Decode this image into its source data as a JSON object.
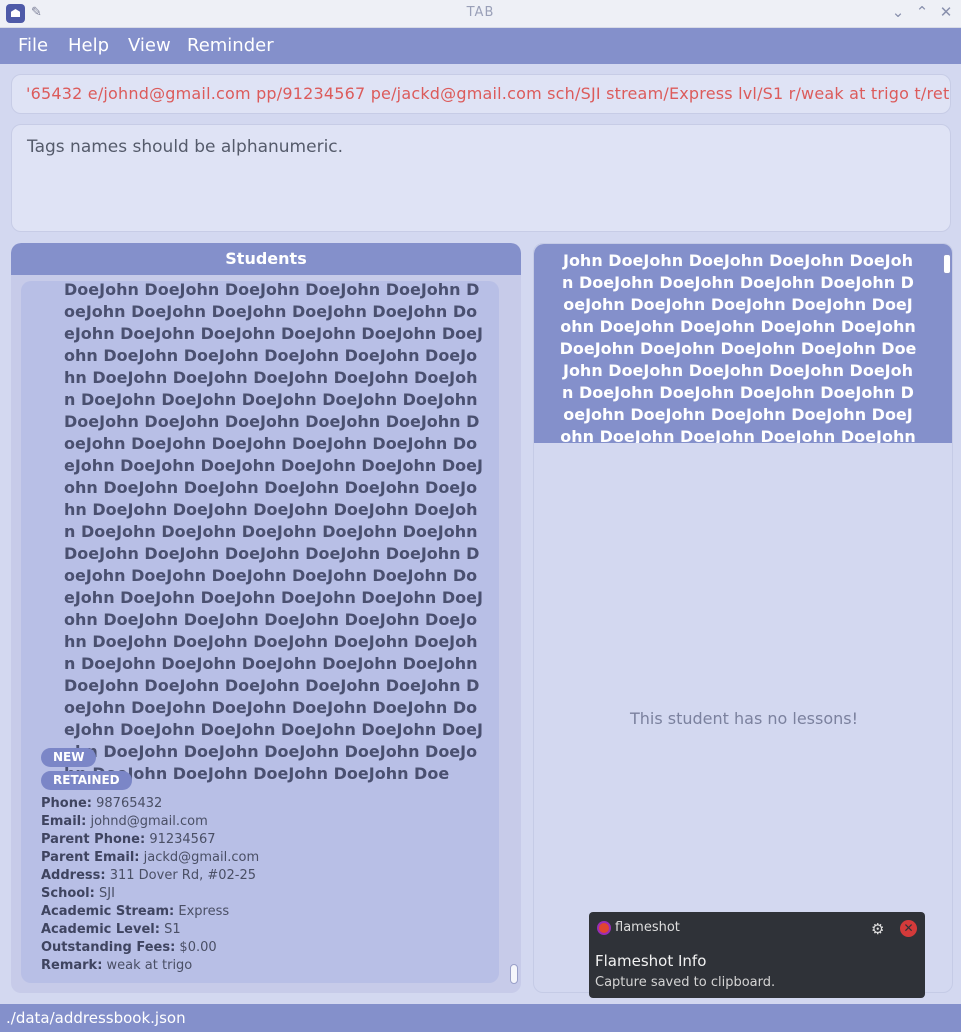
{
  "window": {
    "title": "TAB"
  },
  "menu": [
    "File",
    "Help",
    "View",
    "Reminder"
  ],
  "command": {
    "value": "'65432 e/johnd@gmail.com pp/91234567 pe/jackd@gmail.com sch/SJI stream/Express lvl/S1 r/weak at trigo t/retained t/new"
  },
  "result": {
    "message": "Tags names should be alphanumeric."
  },
  "students": {
    "header": "Students",
    "card": {
      "name": "DoeJohn DoeJohn DoeJohn DoeJohn DoeJohn DoeJohn DoeJohn DoeJohn DoeJohn DoeJohn DoeJohn DoeJohn DoeJohn DoeJohn DoeJohn DoeJohn DoeJohn DoeJohn DoeJohn DoeJohn DoeJohn DoeJohn DoeJohn DoeJohn DoeJohn DoeJohn DoeJohn DoeJohn DoeJohn DoeJohn DoeJohn DoeJohn DoeJohn DoeJohn DoeJohn DoeJohn DoeJohn DoeJohn DoeJohn DoeJohn DoeJohn DoeJohn DoeJohn DoeJohn DoeJohn DoeJohn DoeJohn DoeJohn DoeJohn DoeJohn DoeJohn DoeJohn DoeJohn DoeJohn DoeJohn DoeJohn DoeJohn DoeJohn DoeJohn DoeJohn DoeJohn DoeJohn DoeJohn DoeJohn DoeJohn DoeJohn DoeJohn DoeJohn DoeJohn DoeJohn DoeJohn DoeJohn DoeJohn DoeJohn DoeJohn DoeJohn DoeJohn DoeJohn DoeJohn DoeJohn DoeJohn DoeJohn DoeJohn DoeJohn DoeJohn DoeJohn DoeJohn DoeJohn DoeJohn DoeJohn DoeJohn DoeJohn DoeJohn DoeJohn DoeJohn DoeJohn DoeJohn DoeJohn DoeJohn DoeJohn DoeJohn DoeJohn DoeJohn DoeJohn DoeJohn DoeJohn DoeJohn DoeJohn DoeJohn DoeJohn DoeJohn DoeJohn DoeJohn DoeJohn DoeJohn DoeJohn DoeJohn DoeJohn Doe",
      "tags": [
        "NEW",
        "RETAINED"
      ],
      "fields": [
        {
          "label": "Phone:",
          "value": "98765432"
        },
        {
          "label": "Email:",
          "value": "johnd@gmail.com"
        },
        {
          "label": "Parent Phone:",
          "value": "91234567"
        },
        {
          "label": "Parent Email:",
          "value": "jackd@gmail.com"
        },
        {
          "label": "Address:",
          "value": "311 Dover Rd, #02-25"
        },
        {
          "label": "School:",
          "value": "SJI"
        },
        {
          "label": "Academic Stream:",
          "value": "Express"
        },
        {
          "label": "Academic Level:",
          "value": "S1"
        },
        {
          "label": "Outstanding Fees:",
          "value": "$0.00"
        },
        {
          "label": "Remark:",
          "value": "weak at trigo"
        }
      ]
    }
  },
  "lessons": {
    "student_name": "John DoeJohn DoeJohn DoeJohn DoeJohn DoeJohn DoeJohn DoeJohn DoeJohn DoeJohn DoeJohn DoeJohn DoeJohn DoeJohn DoeJohn DoeJohn DoeJohn DoeJohn DoeJohn DoeJohn DoeJohn DoeJohn DoeJohn DoeJohn DoeJohn DoeJohn DoeJohn DoeJohn DoeJohn DoeJohn DoeJohn DoeJohn DoeJohn DoeJohn DoeJohn DoeJohn DoeJohn DoeJohn DoeJohn DoeJohn DoeJohn DoeJohn DoeJohn DoeJohn DoeJohn DoeJohn DoeJohn DoeJohn",
    "empty_message": "This student has no lessons!"
  },
  "status": {
    "path": "./data/addressbook.json"
  },
  "notification": {
    "app": "flameshot",
    "title": "Flameshot Info",
    "body": "Capture saved to clipboard."
  }
}
